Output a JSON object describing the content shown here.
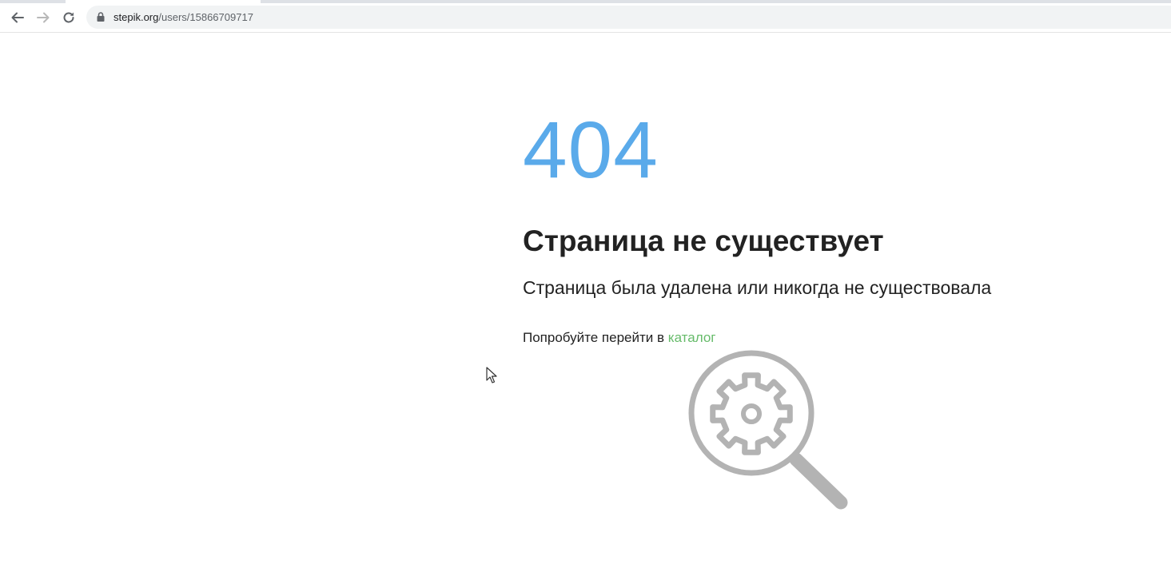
{
  "browser": {
    "url_domain": "stepik.org",
    "url_path": "/users/15866709717"
  },
  "error": {
    "code": "404",
    "title": "Страница не существует",
    "subtitle": "Страница была удалена или никогда не существовала",
    "hint_prefix": "Попробуйте перейти в",
    "catalog_link": "каталог"
  },
  "colors": {
    "code": "#5aaaea",
    "link": "#66bb6a",
    "illustration": "#b3b3b3"
  },
  "icons": {
    "back": "back-arrow-icon",
    "forward": "forward-arrow-icon",
    "reload": "reload-icon",
    "lock": "lock-icon",
    "illustration": "magnifier-gear-icon",
    "cursor": "mouse-cursor-icon"
  }
}
